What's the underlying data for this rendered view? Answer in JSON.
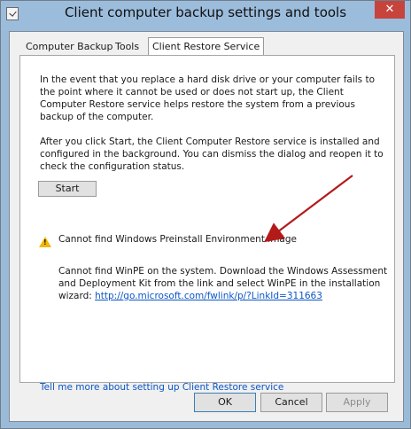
{
  "window": {
    "title": "Client computer backup settings and tools",
    "close_glyph": "✕"
  },
  "tabs": [
    {
      "label": "Computer Backup"
    },
    {
      "label": "Tools"
    },
    {
      "label": "Client Restore Service"
    }
  ],
  "panel": {
    "paragraph1": "In the event that you replace a hard disk drive or your computer fails to the point where it cannot be used or does not start up, the Client Computer Restore service helps restore the system from a previous backup of the computer.",
    "paragraph2": "After you click Start, the Client Computer Restore service is installed and configured in the background. You can dismiss the dialog and reopen it to check the configuration status.",
    "start_label": "Start",
    "warning_title": "Cannot find Windows Preinstall Environment image",
    "warning_body": "Cannot find WinPE on the system. Download the Windows Assessment and Deployment Kit from the link and select WinPE in the installation wizard: ",
    "warning_link": "http://go.microsoft.com/fwlink/p/?LinkId=311663",
    "help_link": "Tell me more about setting up Client Restore service"
  },
  "footer": {
    "ok": "OK",
    "cancel": "Cancel",
    "apply": "Apply"
  },
  "icons": {
    "warning": "warning-icon",
    "arrow_color": "#b31b1b"
  }
}
